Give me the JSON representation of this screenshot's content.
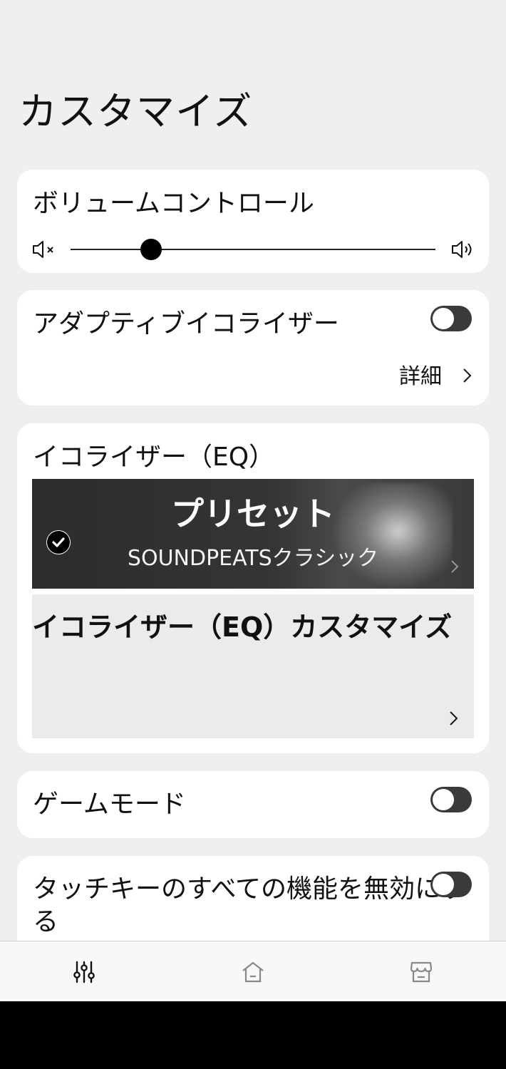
{
  "page_title": "カスタマイズ",
  "volume": {
    "title": "ボリュームコントロール",
    "level": 0.22
  },
  "adaptive_eq": {
    "title": "アダプティブイコライザー",
    "enabled": false,
    "details_label": "詳細"
  },
  "equalizer": {
    "title": "イコライザー（EQ）",
    "preset": {
      "title": "プリセット",
      "selected": "SOUNDPEATSクラシック"
    },
    "custom_label": "イコライザー（EQ）カスタマイズ"
  },
  "game_mode": {
    "title": "ゲームモード",
    "enabled": false
  },
  "touch_keys": {
    "title": "タッチキーのすべての機能を無効にする",
    "enabled": false
  },
  "bottom_nav": [
    {
      "icon": "equalizer-sliders-icon",
      "active": true
    },
    {
      "icon": "home-icon",
      "active": false
    },
    {
      "icon": "store-icon",
      "active": false
    }
  ],
  "colors": {
    "background": "#efefef",
    "card": "#ffffff",
    "toggle_off": "#3a3a3a",
    "system_bar": "#000000"
  }
}
